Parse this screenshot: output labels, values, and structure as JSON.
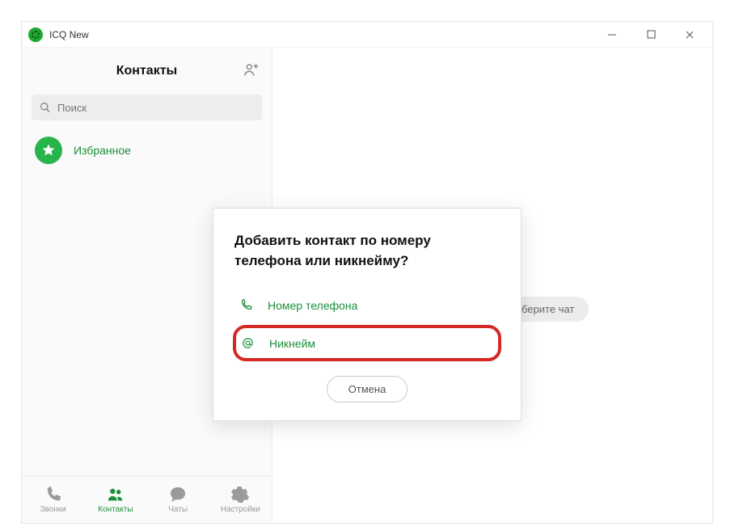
{
  "titlebar": {
    "app_name": "ICQ New"
  },
  "sidebar": {
    "title": "Контакты",
    "search_placeholder": "Поиск",
    "favorites_label": "Избранное"
  },
  "bottom_nav": {
    "calls": "Звонки",
    "contacts": "Контакты",
    "chats": "Чаты",
    "settings": "Настройки"
  },
  "main": {
    "placeholder": "берите чат"
  },
  "modal": {
    "title": "Добавить контакт по номеру телефона или никнейму?",
    "option_phone": "Номер телефона",
    "option_nickname": "Никнейм",
    "cancel": "Отмена"
  },
  "icons": {
    "add_contact": "add-contact-icon",
    "search": "search-icon",
    "star": "star-icon",
    "phone": "phone-icon",
    "at": "at-icon",
    "calls": "calls-icon",
    "contacts": "contacts-icon",
    "chats": "chats-icon",
    "settings": "settings-icon"
  }
}
